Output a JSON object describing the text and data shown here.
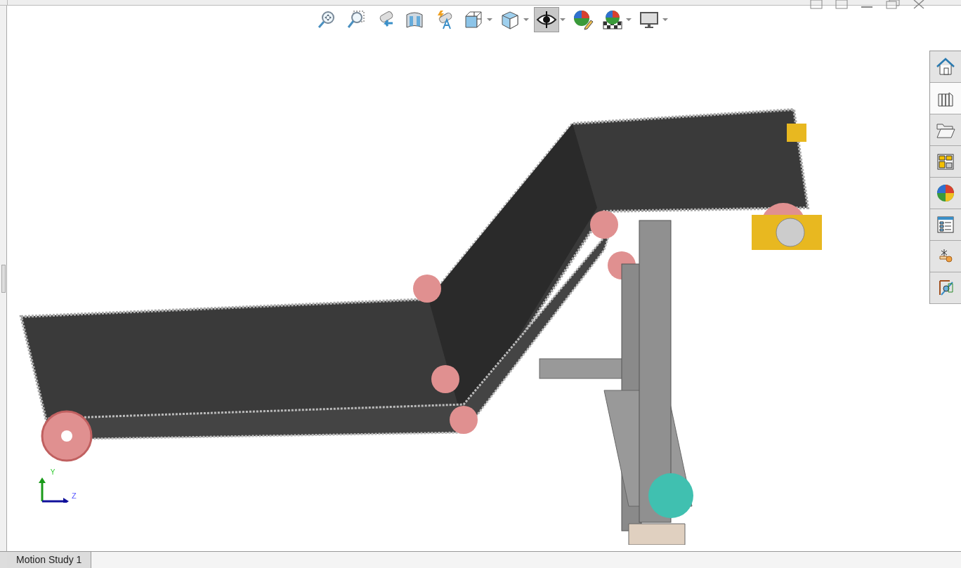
{
  "toolbar": [
    {
      "kind": "zoom-fit",
      "dropdown": false,
      "selected": false
    },
    {
      "kind": "zoom-area",
      "dropdown": false,
      "selected": false
    },
    {
      "kind": "previous-view",
      "dropdown": false,
      "selected": false
    },
    {
      "kind": "section",
      "dropdown": false,
      "selected": false
    },
    {
      "kind": "dynamic-annotation",
      "dropdown": false,
      "selected": false
    },
    {
      "kind": "view-orientation",
      "dropdown": true,
      "selected": false
    },
    {
      "kind": "display-style",
      "dropdown": true,
      "selected": false
    },
    {
      "kind": "hide-show",
      "dropdown": true,
      "selected": true
    },
    {
      "kind": "edit-appearance",
      "dropdown": false,
      "selected": false
    },
    {
      "kind": "scene",
      "dropdown": true,
      "selected": false
    },
    {
      "kind": "view-settings",
      "dropdown": true,
      "selected": false
    }
  ],
  "task_pane": [
    {
      "kind": "resources",
      "selected": false
    },
    {
      "kind": "library",
      "selected": true
    },
    {
      "kind": "explorer",
      "selected": false
    },
    {
      "kind": "palette",
      "selected": false
    },
    {
      "kind": "appearances",
      "selected": false
    },
    {
      "kind": "properties",
      "selected": false
    },
    {
      "kind": "mates",
      "selected": false
    },
    {
      "kind": "motion",
      "selected": false
    }
  ],
  "triad": {
    "y_label": "Y",
    "z_label": "Z"
  },
  "bottom_tabs": [
    {
      "label": "Motion Study 1",
      "selected": true
    }
  ]
}
